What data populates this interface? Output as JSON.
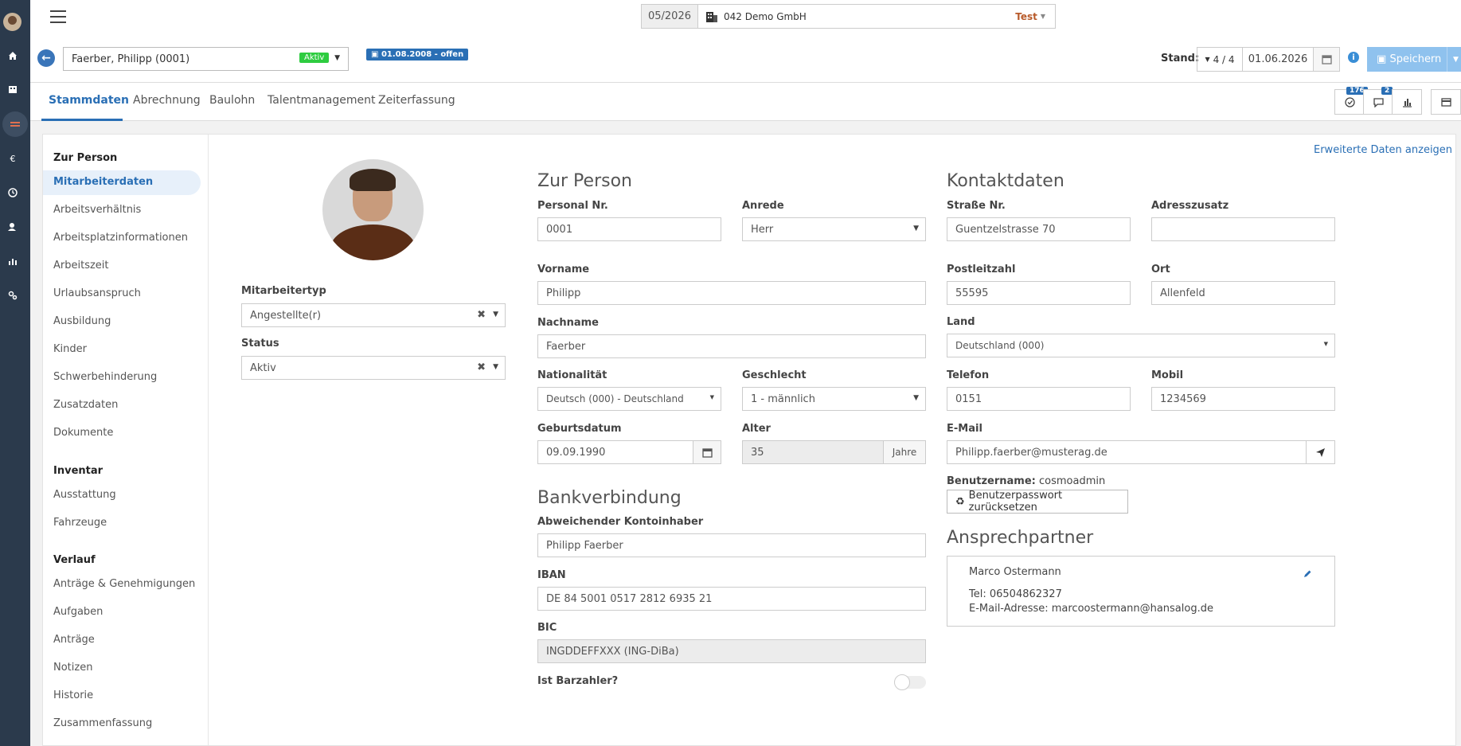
{
  "topbar": {
    "period": "05/2026",
    "company": "042 Demo GmbH",
    "environment": "Test"
  },
  "employee": {
    "selected": "Faerber, Philipp (0001)",
    "status_badge": "Aktiv",
    "date_badge": "01.08.2008 - offen"
  },
  "stand": {
    "label": "Stand:",
    "version": "4 / 4",
    "date": "01.06.2026",
    "save_label": "Speichern"
  },
  "tabs": [
    "Stammdaten",
    "Abrechnung",
    "Baulohn",
    "Talentmanagement",
    "Zeiterfassung"
  ],
  "toolbar": {
    "tasks_count": "176",
    "messages_count": "2"
  },
  "sidebar": {
    "groups": [
      {
        "title": "Zur Person",
        "items": [
          "Mitarbeiterdaten",
          "Arbeitsverhältnis",
          "Arbeitsplatzinformationen",
          "Arbeitszeit",
          "Urlaubsanspruch",
          "Ausbildung",
          "Kinder",
          "Schwerbehinderung",
          "Zusatzdaten",
          "Dokumente"
        ]
      },
      {
        "title": "Inventar",
        "items": [
          "Ausstattung",
          "Fahrzeuge"
        ]
      },
      {
        "title": "Verlauf",
        "items": [
          "Anträge & Genehmigungen",
          "Aufgaben",
          "Anträge",
          "Notizen",
          "Historie",
          "Zusammenfassung"
        ]
      }
    ]
  },
  "left_panel": {
    "mitarbeitertyp_label": "Mitarbeitertyp",
    "mitarbeitertyp_value": "Angestellte(r)",
    "status_label": "Status",
    "status_value": "Aktiv"
  },
  "extended_link": "Erweiterte Daten anzeigen",
  "person": {
    "title": "Zur Person",
    "personal_nr_label": "Personal Nr.",
    "personal_nr": "0001",
    "anrede_label": "Anrede",
    "anrede": "Herr",
    "vorname_label": "Vorname",
    "vorname": "Philipp",
    "nachname_label": "Nachname",
    "nachname": "Faerber",
    "nationalitaet_label": "Nationalität",
    "nationalitaet": "Deutsch (000) - Deutschland",
    "geschlecht_label": "Geschlecht",
    "geschlecht": "1 - männlich",
    "geburtsdatum_label": "Geburtsdatum",
    "geburtsdatum": "09.09.1990",
    "alter_label": "Alter",
    "alter": "35",
    "alter_unit": "Jahre"
  },
  "bank": {
    "title": "Bankverbindung",
    "kontoinhaber_label": "Abweichender Kontoinhaber",
    "kontoinhaber": "Philipp Faerber",
    "iban_label": "IBAN",
    "iban": "DE 84 5001 0517 2812 6935 21",
    "bic_label": "BIC",
    "bic": "INGDDEFFXXX (ING-DiBa)",
    "barzahler_label": "Ist Barzahler?"
  },
  "contact": {
    "title": "Kontaktdaten",
    "strasse_label": "Straße Nr.",
    "strasse": "Guentzelstrasse 70",
    "adresszusatz_label": "Adresszusatz",
    "adresszusatz": "",
    "plz_label": "Postleitzahl",
    "plz": "55595",
    "ort_label": "Ort",
    "ort": "Allenfeld",
    "land_label": "Land",
    "land": "Deutschland (000)",
    "telefon_label": "Telefon",
    "telefon": "0151",
    "mobil_label": "Mobil",
    "mobil": "1234569",
    "email_label": "E-Mail",
    "email": "Philipp.faerber@musterag.de",
    "username_label": "Benutzername:",
    "username": "cosmoadmin",
    "reset_label": "Benutzerpasswort zurücksetzen"
  },
  "ansprechpartner": {
    "title": "Ansprechpartner",
    "name": "Marco Ostermann",
    "tel": "Tel: 06504862327",
    "email": "E-Mail-Adresse: marcoostermann@hansalog.de"
  }
}
